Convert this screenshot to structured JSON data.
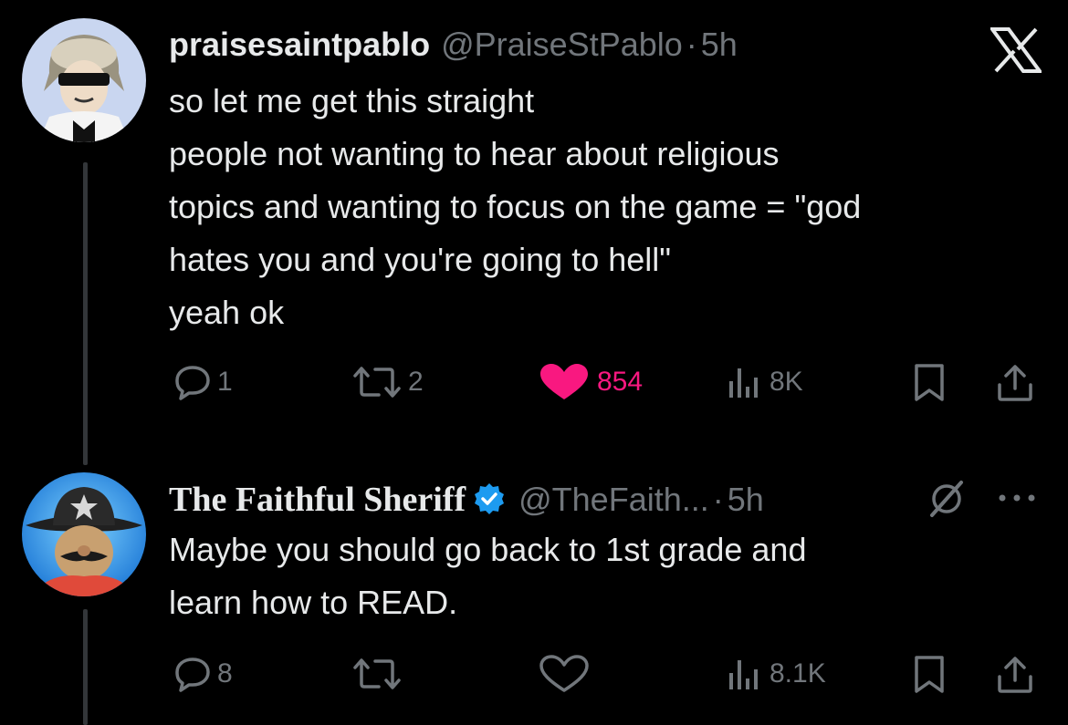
{
  "tweet": {
    "display_name": "praisesaintpablo",
    "handle": "@PraiseStPablo",
    "separator": "·",
    "time": "5h",
    "lines": [
      "so let me get this straight",
      "people not wanting to hear about religious",
      "topics and wanting to focus on the game = \"god",
      "hates you and you're going to hell\"",
      "yeah ok"
    ],
    "replies": "1",
    "reposts": "2",
    "likes": "854",
    "views": "8K",
    "liked": true,
    "corner_icon": "x-logo-icon"
  },
  "reply": {
    "display_name": "The Faithful Sheriff",
    "verified": true,
    "handle": "@TheFaith...",
    "separator": "·",
    "time": "5h",
    "lines": [
      "Maybe you should go back to 1st grade and",
      "learn how to READ."
    ],
    "replies": "8",
    "reposts": "",
    "likes": "",
    "views": "8.1K",
    "liked": false
  },
  "colors": {
    "background": "#000000",
    "text": "#e7e9ea",
    "muted": "#71767b",
    "like_pink": "#f91880",
    "verified_blue": "#1d9bf0",
    "thread_line": "#333639"
  }
}
